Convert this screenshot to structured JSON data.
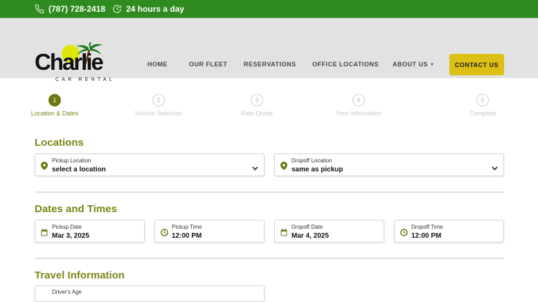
{
  "topbar": {
    "phone": "(787) 728-2418",
    "hours": "24 hours a day",
    "icons": {
      "phone": "phone-icon",
      "hours": "clock-icon"
    }
  },
  "logo": {
    "brand": "Charlie",
    "tagline": "CAR RENTAL"
  },
  "nav": {
    "home": "HOME",
    "fleet": "OUR FLEET",
    "reservations": "RESERVATIONS",
    "offices": "OFFICE LOCATIONS",
    "about": "ABOUT US",
    "contact": "CONTACT US"
  },
  "steps": [
    {
      "num": "1",
      "label": "Location & Dates",
      "active": true
    },
    {
      "num": "2",
      "label": "Vehicle Selection",
      "active": false
    },
    {
      "num": "3",
      "label": "Rate Quote",
      "active": false
    },
    {
      "num": "4",
      "label": "Your Information",
      "active": false
    },
    {
      "num": "5",
      "label": "Complete",
      "active": false
    }
  ],
  "sections": {
    "locations": "Locations",
    "dates": "Dates and Times",
    "travel": "Travel Information"
  },
  "locations": {
    "pickup": {
      "label": "Pickup Location",
      "value": "select a location"
    },
    "dropoff": {
      "label": "Dropoff Location",
      "value": "same as pickup"
    }
  },
  "dates": {
    "pickup_date": {
      "label": "Pickup Date",
      "value": "Mar 3, 2025"
    },
    "pickup_time": {
      "label": "Pickup Time",
      "value": "12:00 PM"
    },
    "dropoff_date": {
      "label": "Dropoff Date",
      "value": "Mar 4, 2025"
    },
    "dropoff_time": {
      "label": "Dropoff Time",
      "value": "12:00 PM"
    }
  },
  "travel": {
    "age": {
      "label": "Driver's Age"
    }
  },
  "colors": {
    "topbar": "#2f8a1f",
    "accent": "#7d8617",
    "button": "#dcc015"
  }
}
